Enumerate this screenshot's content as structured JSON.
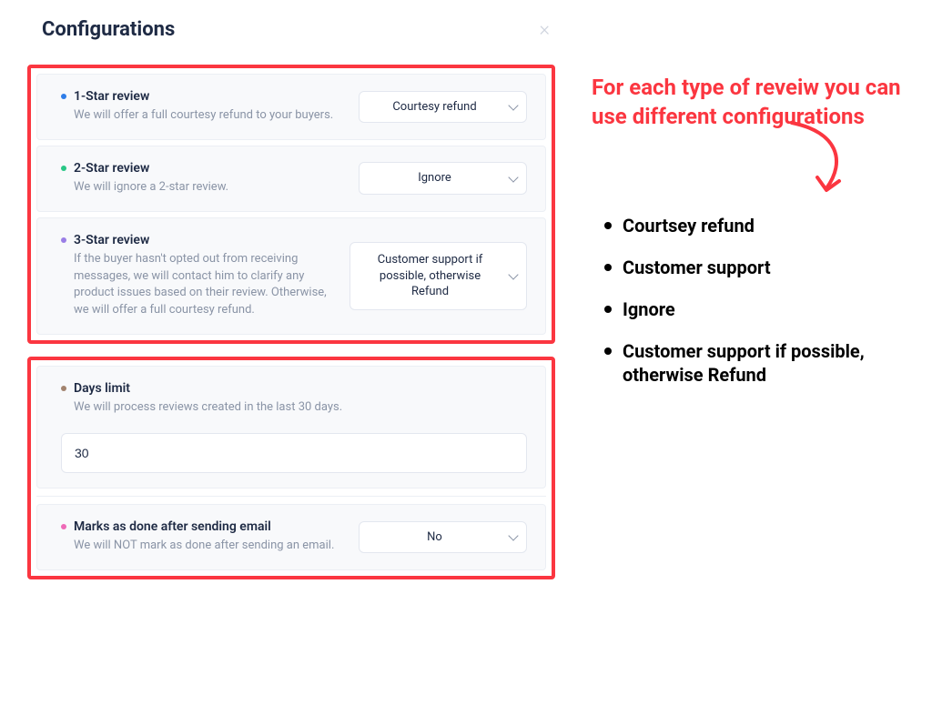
{
  "panel": {
    "title": "Configurations",
    "rows": {
      "one_star": {
        "title": "1-Star review",
        "desc": "We will offer a full courtesy refund to your buyers.",
        "selected": "Courtesy refund"
      },
      "two_star": {
        "title": "2-Star review",
        "desc": "We will ignore a 2-star review.",
        "selected": "Ignore"
      },
      "three_star": {
        "title": "3-Star review",
        "desc": "If the buyer hasn't opted out from receiving messages, we will contact him to clarify any product issues based on their review. Otherwise, we will offer a full courtesy refund.",
        "selected": "Customer support if possible, otherwise Refund"
      },
      "days_limit": {
        "title": "Days limit",
        "desc": "We will process reviews created in the last 30 days.",
        "value": "30"
      },
      "mark_done": {
        "title": "Marks as done after sending email",
        "desc": "We will NOT mark as done after sending an email.",
        "selected": "No"
      }
    }
  },
  "annotation": {
    "headline": "For each type of reveiw you can use different configurations",
    "options": [
      "Courtsey refund",
      "Customer support",
      "Ignore",
      "Customer support if possible, otherwise Refund"
    ]
  }
}
